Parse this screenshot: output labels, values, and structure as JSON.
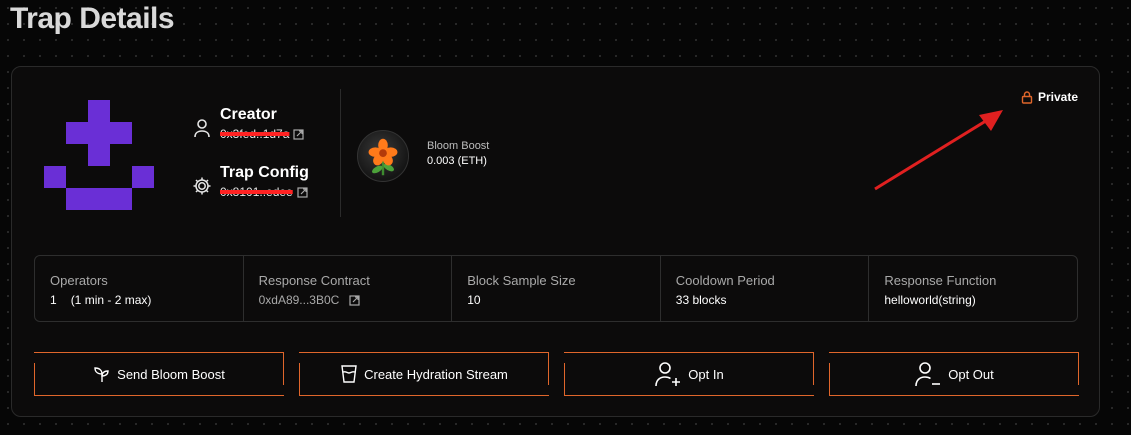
{
  "page": {
    "title": "Trap Details"
  },
  "colors": {
    "accent": "#e0662b",
    "avatar": "#6a2fd6",
    "redaction": "#ff2323"
  },
  "trap": {
    "creator_label": "Creator",
    "creator_address": "0x3fed..1d7a",
    "config_label": "Trap Config",
    "config_address": "0x8101..edee",
    "visibility": "Private"
  },
  "bloom_boost": {
    "label": "Bloom Boost",
    "value": "0.003 (ETH)",
    "icon": "flower-icon"
  },
  "info": {
    "operators": {
      "label": "Operators",
      "count": "1",
      "range": "(1 min - 2 max)"
    },
    "response_contract": {
      "label": "Response Contract",
      "value": "0xdA89...3B0C"
    },
    "block_sample_size": {
      "label": "Block Sample Size",
      "value": "10"
    },
    "cooldown_period": {
      "label": "Cooldown Period",
      "value": "33 blocks"
    },
    "response_function": {
      "label": "Response Function",
      "value": "helloworld(string)"
    }
  },
  "actions": {
    "send_bloom_boost": "Send Bloom Boost",
    "create_hydration_stream": "Create Hydration Stream",
    "opt_in": "Opt In",
    "opt_out": "Opt Out"
  }
}
